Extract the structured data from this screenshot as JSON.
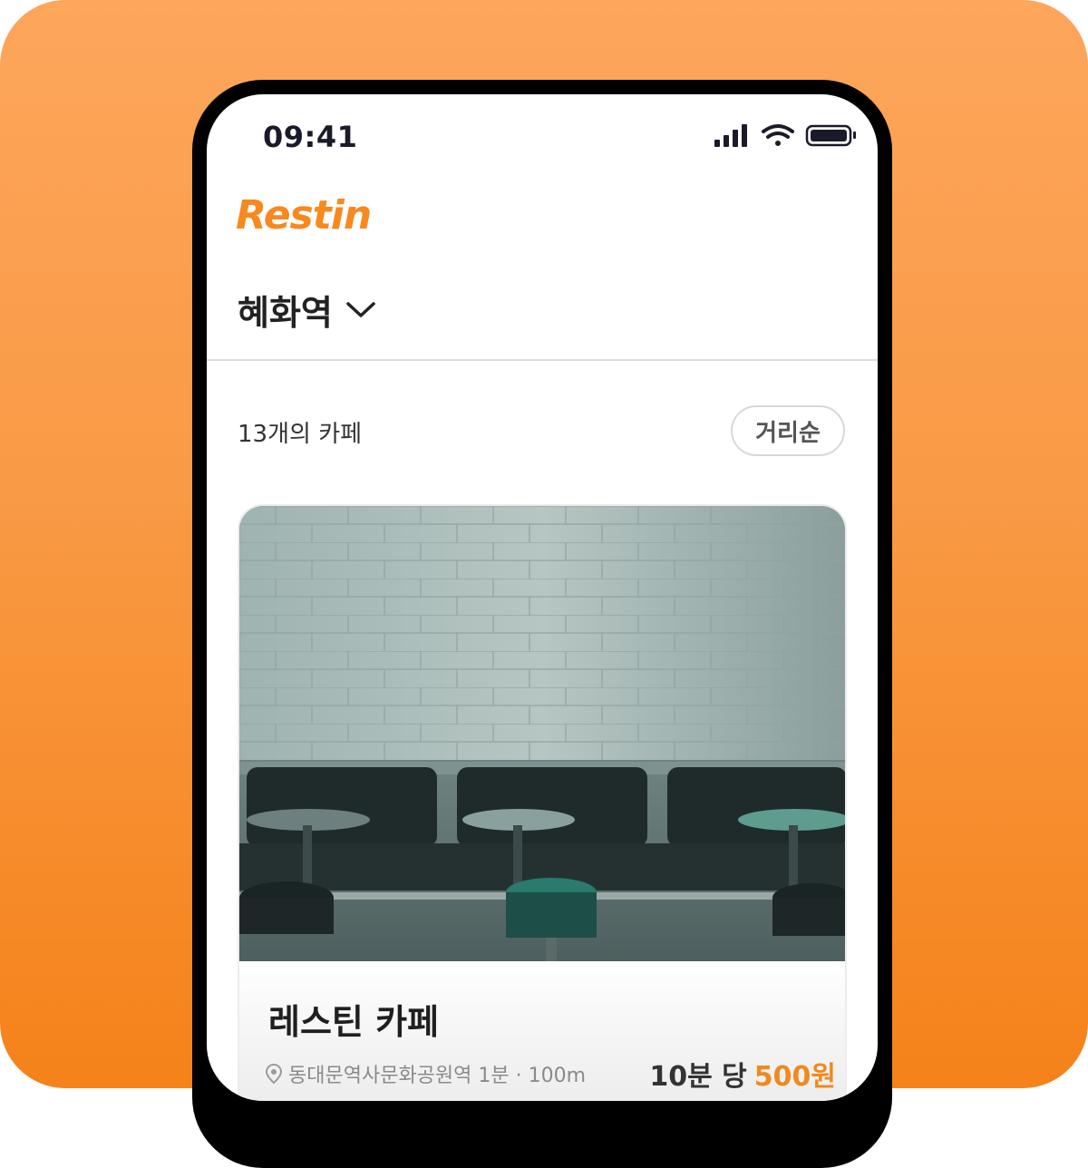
{
  "status_bar": {
    "time": "09:41"
  },
  "header": {
    "logo": "Restin"
  },
  "location_selector": {
    "station": "혜화역"
  },
  "list": {
    "count_label": "13개의 카페",
    "sort_label": "거리순"
  },
  "cafes": [
    {
      "name": "레스틴 카페",
      "location": "동대문역사문화공원역 1분 · 100m",
      "price_unit": "10분 당",
      "price_amount": "500원"
    }
  ],
  "colors": {
    "brand": "#f7891f",
    "background_top": "#fda65c",
    "background_bottom": "#f5821a"
  }
}
